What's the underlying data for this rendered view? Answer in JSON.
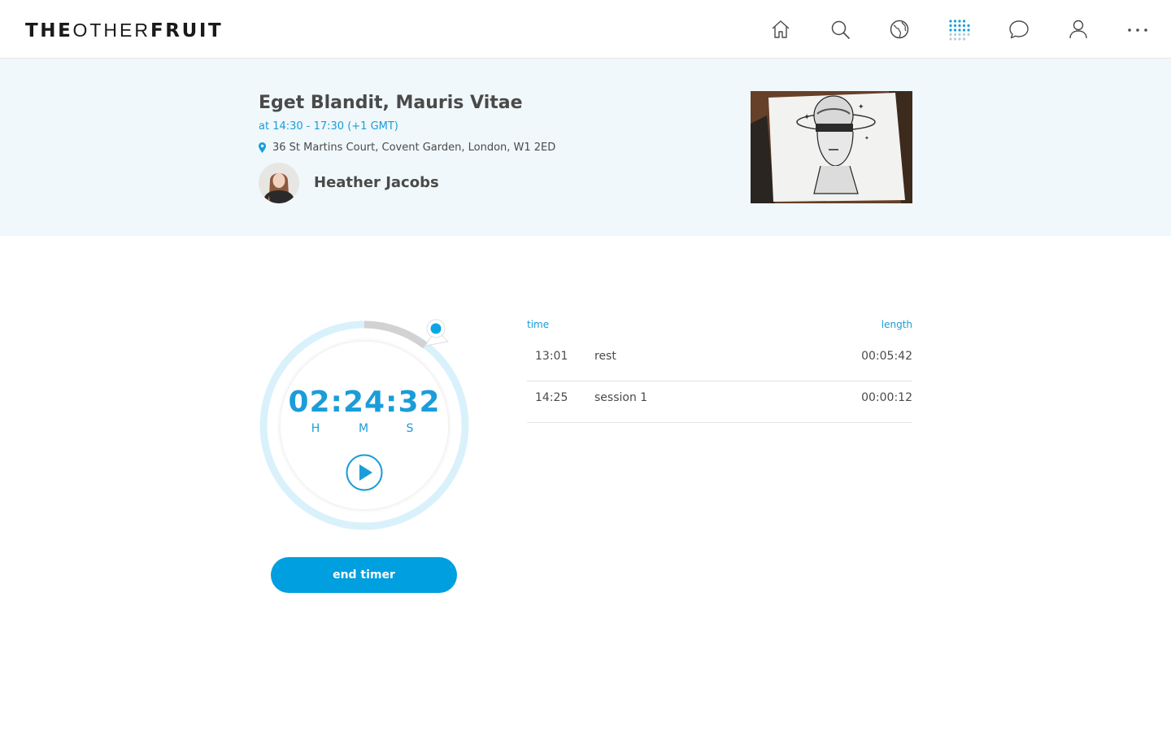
{
  "header": {
    "logo_part1": "THE",
    "logo_part2": "OTHER",
    "logo_part3": "FRUIT",
    "nav_icons": [
      "home-icon",
      "search-icon",
      "globe-icon",
      "grid-icon",
      "chat-icon",
      "profile-icon",
      "more-icon"
    ],
    "active_icon": "grid-icon"
  },
  "event": {
    "title": "Eget Blandit, Mauris Vitae",
    "time": "at 14:30 - 17:30 (+1 GMT)",
    "address": "36 St Martins Court, Covent Garden, London, W1 2ED",
    "host_name": "Heather Jacobs"
  },
  "timer": {
    "display": "02:24:32",
    "unit_hours": "H",
    "unit_minutes": "M",
    "unit_seconds": "S",
    "end_label": "end timer"
  },
  "log": {
    "header_time": "time",
    "header_length": "length",
    "rows": [
      {
        "time": "13:01",
        "label": "rest",
        "length": "00:05:42"
      },
      {
        "time": "14:25",
        "label": "session 1",
        "length": "00:00:12"
      }
    ]
  },
  "colors": {
    "accent": "#009fdf",
    "text": "#4a4a4a",
    "banner_bg": "#f0f8fb",
    "ring_light": "#d9f1fb"
  }
}
